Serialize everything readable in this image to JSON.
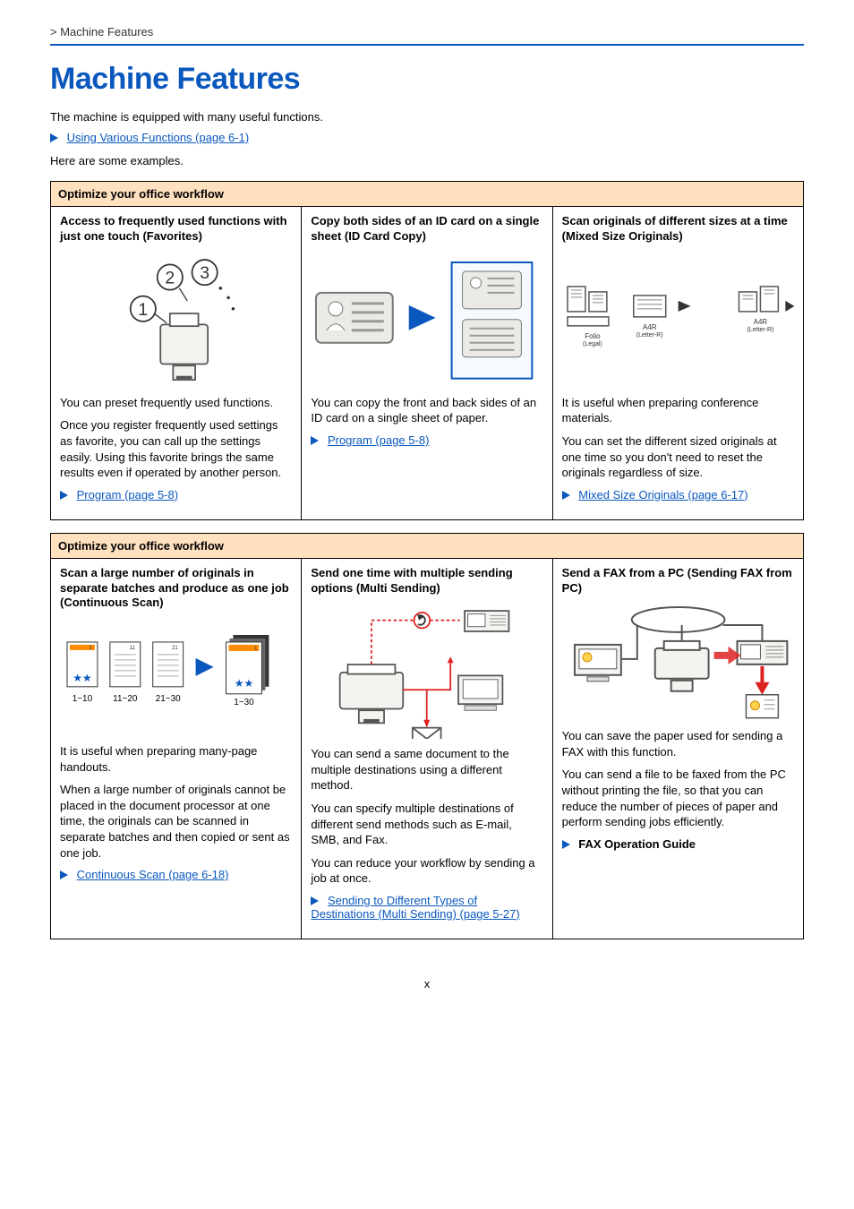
{
  "breadcrumb": " > Machine Features",
  "title": "Machine Features",
  "intro1": "The machine is equipped with many useful functions.",
  "topLink": "Using Various Functions (page 6-1)",
  "intro2": "Here are some examples.",
  "box1": {
    "header": "Optimize your office workflow",
    "c1": {
      "title": "Access to frequently used functions with just one touch (Favorites)",
      "p1": "You can preset frequently used functions.",
      "p2": "Once you register frequently used settings as favorite, you can call up the settings easily. Using this favorite brings the same results even if operated by another person.",
      "link": "Program (page 5-8)"
    },
    "c2": {
      "title": "Copy both sides of an ID card on a single sheet (ID Card Copy)",
      "p1": "You can copy the front and back sides of an ID card on a single sheet of paper.",
      "link": "Program (page 5-8)"
    },
    "c3": {
      "title": "Scan originals of different sizes at a time (Mixed Size Originals)",
      "p1": "It is useful when preparing conference materials.",
      "p2": "You can set the different sized originals at one time so you don't need to reset the originals regardless of size.",
      "link": "Mixed Size Originals (page 6-17)",
      "label_folio": "Folio",
      "label_legal": "(Legal)",
      "label_a4r": "A4R",
      "label_letterr": "(Letter-R)"
    }
  },
  "box2": {
    "header": "Optimize your office workflow",
    "c1": {
      "title": "Scan a large number of originals in separate batches and produce as one job (Continuous Scan)",
      "p1": "It is useful when preparing many-page handouts.",
      "p2": "When a large number of originals cannot be placed in the document processor at one time, the originals can be scanned in separate batches and then copied or sent as one job.",
      "link": "Continuous Scan (page 6-18)",
      "lbl_a": "1~10",
      "lbl_b": "11~20",
      "lbl_c": "21~30",
      "lbl_d": "1~30"
    },
    "c2": {
      "title": "Send one time with multiple sending options (Multi Sending)",
      "p1": "You can send a same document to the multiple destinations using a different method.",
      "p2": "You can specify multiple destinations of different send methods such as E-mail, SMB, and Fax.",
      "p3": "You can reduce your workflow by sending a job at once.",
      "link": "Sending to Different Types of Destinations (Multi Sending) (page 5-27)"
    },
    "c3": {
      "title": "Send a FAX from a PC (Sending FAX from PC)",
      "p1": "You can save the paper used for sending a FAX with this function.",
      "p2": "You can send a file to be faxed from the PC without printing the file, so that you can reduce the number of pieces of paper and perform sending jobs efficiently.",
      "link": "FAX Operation Guide"
    }
  },
  "pagenum": "x"
}
